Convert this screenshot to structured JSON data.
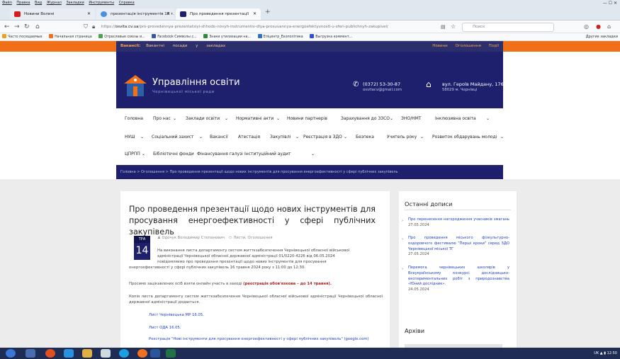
{
  "browser": {
    "menu": [
      "Файл",
      "Правка",
      "Вид",
      "Журнал",
      "Закладки",
      "Инструменты",
      "Справка"
    ],
    "tabs": [
      {
        "label": "Новини Волині"
      },
      {
        "label": "презентація інструментів 16 т."
      },
      {
        "label": "Про проведення презентації"
      }
    ],
    "url_prefix": "https://",
    "url_domain": "osvita.cv.ua",
    "url_path": "/pro-provedennya-prezentatsiyi-shhodo-novyh-instrumentiv-dlya-prosuvannya-energoefektyvnosti-u-sferi-publichnyh-zakupivel/",
    "search_placeholder": "Поиск",
    "bookmarks": [
      {
        "label": "Часто посещаемые",
        "color": "#f0a020"
      },
      {
        "label": "Начальная страница",
        "color": "#f07020"
      },
      {
        "label": "Отраслевые союзы и...",
        "color": "#50a050"
      },
      {
        "label": "Facebook Символы с...",
        "color": "#3b5998"
      },
      {
        "label": "Знаки утилизации на...",
        "color": "#2a8a3a"
      },
      {
        "label": "Епіцентр_Екополітика",
        "color": "#3070c0"
      },
      {
        "label": "Выгрузка коммент...",
        "color": "#3050d0"
      }
    ],
    "other_bookmarks": "Другие закладки"
  },
  "site": {
    "vacancy_label": "Вакансії:",
    "vacancy_links": [
      "Вакантні",
      "посади",
      "у",
      "закладах"
    ],
    "top_right": [
      "Новини",
      "Оголошення",
      "Події"
    ],
    "logo_title": "Управління освіти",
    "logo_subtitle": "Чернівецької міської ради",
    "phone": "(0372) 53-30-87",
    "email": "osvitacv@gmail.com",
    "address1": "вул. Героїв Майдану, 176",
    "address2": "58029 м. Чернівці",
    "menu_row1": [
      "Головна",
      "Про нас",
      "Заклади освіти",
      "Нормативні акти",
      "Новини партнерів",
      "Зарахування до ЗЗСО",
      "ЗНО/НМТ",
      "Інклюзивна освіта"
    ],
    "menu_row2": [
      "НУШ",
      "Соціальний захист",
      "Вакансії",
      "Атестація",
      "Закупівлі",
      "Реєстрація в ЗДО",
      "Безпека",
      "Учитель року",
      "Розвиток обдарувань молоді"
    ],
    "menu_row3": [
      "ЦПРПП",
      "Бібліотечні фонди",
      "Фінансування галузі",
      "Інституційний аудит"
    ],
    "breadcrumb": "Головна  >  Оголошення  >  Про проведення презентації щодо нових інструментів для просування енергоефективності у сфері публічних закупівель"
  },
  "article": {
    "title": "Про проведення презентації щодо нових інструментів для просування енергоефективності у сфері публічних закупівель",
    "date_month": "ТРА",
    "date_day": "14",
    "author": "Одочук Володимир Степанович",
    "categories": "Листи, Оголошення",
    "para1a": "На виконання листа департаменту систем життєзабезпечення Чернівецької обласної військової",
    "para1b": "адміністрації Чернівецької обласної державної адміністрації 01/0220-4226 від 06.05.2024",
    "para1c": "повідомляємо про проведення презентації щодо нових інструментів для просування",
    "para1d": "енергоефективності у сфері публічних закупівель 16 травня 2024 року з 11:00 до 12:30.",
    "para2": "Просимо зацікавлених осіб взяти онлайн участь в заході",
    "para2_bold": "(реєстрація обов'язкова – до 14 травня).",
    "para3": "Копія листа департаменту систем життєзабезпечення Чернівецької обласної військової адміністрації Чернівецької обласної державної адміністрації додається.",
    "link1": "Лист Чернівецька МР 16.05.",
    "link2": "Лист ОДА 16.05.",
    "link3": "Реєстрація \"Нові інструменти для просування енергоефективності у сфері публічних закупівель\" (google.com)"
  },
  "sidebar": {
    "recent_title": "Останні дописи",
    "posts": [
      {
        "text": "Про перенесення нагородження учасників змагань",
        "date": "27.05.2024"
      },
      {
        "text": "Про проведення міського фізкультурно-оздоровчого фестивалю \"Перші кроки\" серед ЗДО Чернівецької міської ТГ",
        "date": "27.05.2024"
      },
      {
        "text": "Перемога чернівецьких школярів у Всеукраїнському конкурсі дослідницько-експериментальних робіт з природознавства «Юний дослідник».",
        "date": "24.05.2024"
      }
    ],
    "archive_title": "Архіви"
  },
  "taskbar": {
    "tray": "UK",
    "time": "12:50"
  }
}
